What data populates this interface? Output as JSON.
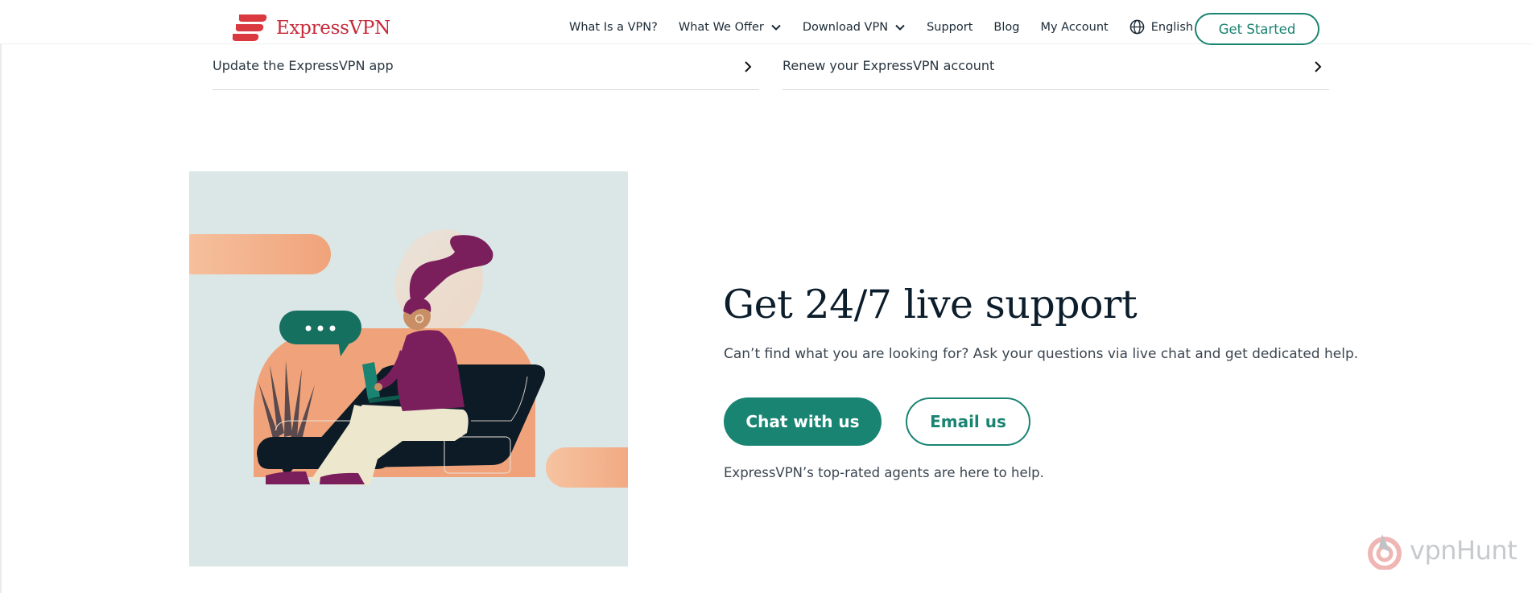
{
  "header": {
    "brand": "ExpressVPN",
    "nav": [
      {
        "label": "What Is a VPN?",
        "dropdown": false
      },
      {
        "label": "What We Offer",
        "dropdown": true
      },
      {
        "label": "Download VPN",
        "dropdown": true
      },
      {
        "label": "Support",
        "dropdown": false
      },
      {
        "label": "Blog",
        "dropdown": false
      },
      {
        "label": "My Account",
        "dropdown": false
      },
      {
        "label": "English",
        "icon": "globe-icon"
      }
    ],
    "cta": "Get Started"
  },
  "links": [
    {
      "label": "Update the ExpressVPN app",
      "icon": "chevron-right-icon"
    },
    {
      "label": "Renew your ExpressVPN account",
      "icon": "chevron-right-icon"
    }
  ],
  "support": {
    "title": "Get 24/7 live support",
    "description": "Can’t find what you are looking for? Ask your questions via live chat and get dedicated help.",
    "chat_button": "Chat with us",
    "email_button": "Email us",
    "note": "ExpressVPN’s top-rated agents are here to help."
  },
  "watermark": "vpnHunt",
  "colors": {
    "brand_red": "#c8293a",
    "accent_green": "#1a8472",
    "navy": "#0c1d2b",
    "panel_bg": "#dbe6e6",
    "orange": "#f2a57a",
    "purple": "#7a1f5c"
  }
}
